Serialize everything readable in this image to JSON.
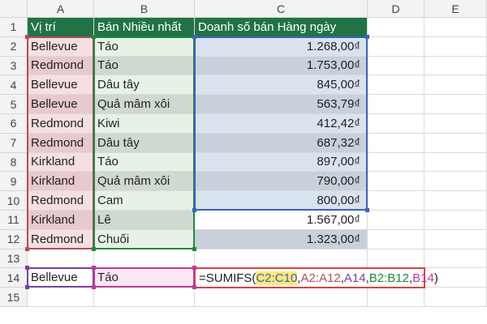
{
  "columns": [
    "A",
    "B",
    "C",
    "D",
    "E"
  ],
  "rows": [
    "1",
    "2",
    "3",
    "4",
    "5",
    "6",
    "7",
    "8",
    "9",
    "10",
    "11",
    "12",
    "13",
    "14",
    "15"
  ],
  "headers": {
    "a": "Vị trí",
    "b": "Bán Nhiều nhất",
    "c": "Doanh số bán Hàng ngày"
  },
  "data": [
    {
      "location": "Bellevue",
      "item": "Táo",
      "sales": "1.268,00₫"
    },
    {
      "location": "Redmond",
      "item": "Táo",
      "sales": "1.753,00₫"
    },
    {
      "location": "Bellevue",
      "item": "Dâu tây",
      "sales": "845,00₫"
    },
    {
      "location": "Bellevue",
      "item": "Quả mâm xôi",
      "sales": "563,79₫"
    },
    {
      "location": "Redmond",
      "item": "Kiwi",
      "sales": "412,42₫"
    },
    {
      "location": "Redmond",
      "item": "Dâu tây",
      "sales": "687,32₫"
    },
    {
      "location": "Kirkland",
      "item": "Táo",
      "sales": "897,00₫"
    },
    {
      "location": "Kirkland",
      "item": "Quả mâm xôi",
      "sales": "790,00₫"
    },
    {
      "location": "Redmond",
      "item": "Cam",
      "sales": "800,00₫"
    },
    {
      "location": "Kirkland",
      "item": "Lê",
      "sales": "1.567,00₫"
    },
    {
      "location": "Redmond",
      "item": "Chuối",
      "sales": "1.323,00₫"
    }
  ],
  "criteria": {
    "a14": "Bellevue",
    "b14": "Táo"
  },
  "formula": {
    "prefix": "=SUMIFS(",
    "arg1": "C2:C10",
    "sep1": ",",
    "arg2": "A2:A12",
    "sep2": ",",
    "arg3": "A14",
    "sep3": ",",
    "arg4": "B2:B12",
    "sep4": ",",
    "arg5": "B14",
    "suffix": ")"
  },
  "colors": {
    "header_green": "#217346",
    "range_c": "#3a63b8",
    "range_a": "#b34b5a",
    "range_a14": "#7b3fa0",
    "range_b": "#1e8a3a",
    "range_b14": "#c0399a",
    "formula_border": "#d9453d"
  }
}
